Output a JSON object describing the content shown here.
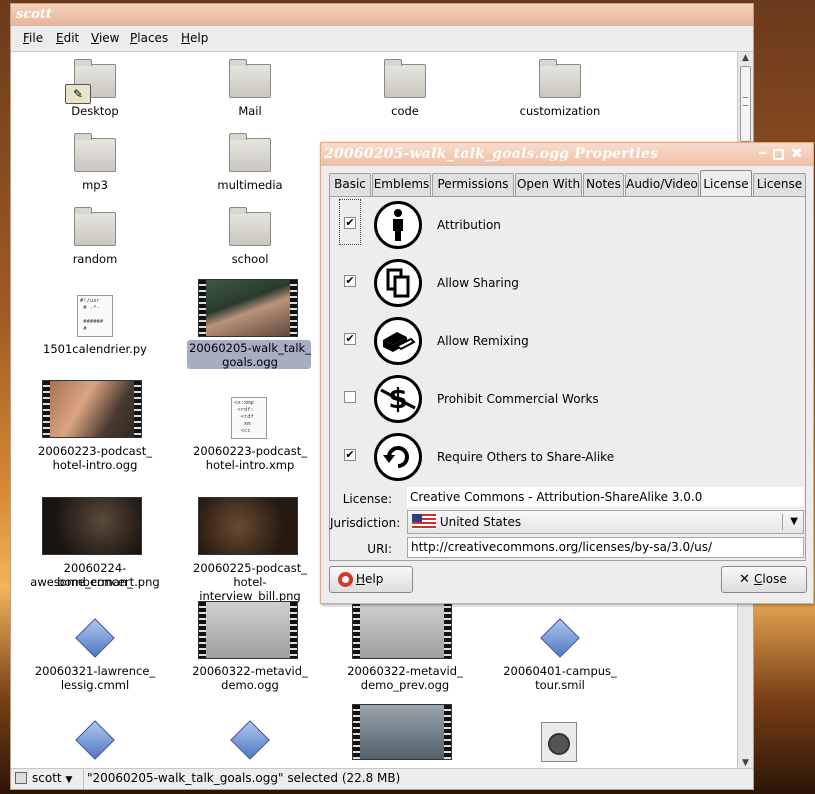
{
  "file_manager": {
    "title": "scott",
    "menu": [
      {
        "mn": "F",
        "rest": "ile"
      },
      {
        "mn": "E",
        "rest": "dit"
      },
      {
        "mn": "V",
        "rest": "iew"
      },
      {
        "mn": "P",
        "rest": "laces"
      },
      {
        "mn": "H",
        "rest": "elp"
      }
    ],
    "items": {
      "desktop": "Desktop",
      "mail": "Mail",
      "code": "code",
      "customization": "customization",
      "mp3": "mp3",
      "multimedia": "multimedia",
      "random": "random",
      "school": "school",
      "py_file": "1501calendrier.py",
      "py_preview": "#!/usr\n # -*-\n\n ######\n #",
      "walk_talk_1": "20060205-walk_talk_",
      "walk_talk_2": "goals.ogg",
      "podcast_ogg_1": "20060223-podcast_",
      "podcast_ogg_2": "hotel-intro.ogg",
      "podcast_xmp_1": "20060223-podcast_",
      "podcast_xmp_2": "hotel-intro.xmp",
      "xmp_preview": "<x:xmp\n <rdf:\n  <rdf\n   xm\n  <cc",
      "bomber_1": "20060224-bomberman_",
      "bomber_2": "awesome_concert.png",
      "interview_1": "20060225-podcast_",
      "interview_2": "hotel-interview_bill.png",
      "lessig_1": "20060321-lawrence_",
      "lessig_2": "lessig.cmml",
      "metavid_1": "20060322-metavid_",
      "metavid_2": "demo.ogg",
      "metavid_prev_1": "20060322-metavid_",
      "metavid_prev_2": "demo_prev.ogg",
      "campus_1": "20060401-campus_",
      "campus_2": "tour.smil"
    },
    "status": {
      "location": "scott",
      "message": "\"20060205-walk_talk_goals.ogg\" selected (22.8 MB)"
    }
  },
  "dialog": {
    "title": "20060205-walk_talk_goals.ogg Properties",
    "tabs": [
      "Basic",
      "Emblems",
      "Permissions",
      "Open With",
      "Notes",
      "Audio/Video",
      "License",
      "License"
    ],
    "active_tab": "License",
    "license_options": [
      {
        "label": "Attribution",
        "checked": true,
        "icon": "attribution-icon"
      },
      {
        "label": "Allow Sharing",
        "checked": true,
        "icon": "sharing-icon"
      },
      {
        "label": "Allow Remixing",
        "checked": true,
        "icon": "remixing-icon"
      },
      {
        "label": "Prohibit Commercial Works",
        "checked": false,
        "icon": "noncommercial-icon"
      },
      {
        "label": "Require Others to Share-Alike",
        "checked": true,
        "icon": "sharealike-icon"
      }
    ],
    "fields": {
      "license_label": "License:",
      "license_value": "Creative Commons - Attribution-ShareAlike 3.0.0",
      "jurisdiction_label": "Jurisdiction:",
      "jurisdiction_value": "United States",
      "uri_label": "URI:",
      "uri_value": "http://creativecommons.org/licenses/by-sa/3.0/us/"
    },
    "buttons": {
      "help_mn": "H",
      "help_rest": "elp",
      "close_mn": "C",
      "close_rest": "lose"
    }
  },
  "colors": {
    "titlebar": "#e7b49a",
    "selection": "#a7aec2"
  }
}
